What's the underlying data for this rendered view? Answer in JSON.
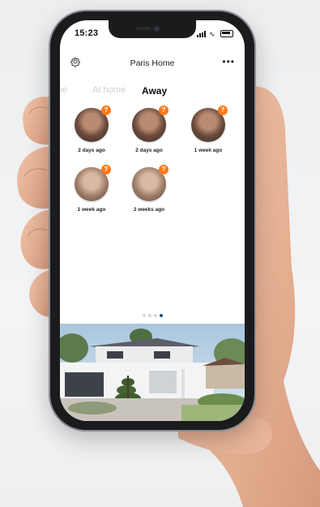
{
  "status_bar": {
    "time": "15:23"
  },
  "header": {
    "title": "Paris Home",
    "more_label": "•••"
  },
  "tabs": [
    {
      "label": "me"
    },
    {
      "label": "At home"
    },
    {
      "label": "Away",
      "active": true
    }
  ],
  "faces": [
    {
      "badge": "?",
      "label": "2 days ago"
    },
    {
      "badge": "?",
      "label": "2 days ago"
    },
    {
      "badge": "?",
      "label": "1 week ago"
    },
    {
      "badge": "?",
      "label": "1 week ago"
    },
    {
      "badge": "?",
      "label": "2 weeks ago"
    }
  ],
  "pager": {
    "pages": 4,
    "active_index": 3
  },
  "icons": {
    "settings": "gear-icon",
    "more": "more-dots-icon",
    "badge": "question-badge-icon"
  },
  "colors": {
    "accent": "#ff7a1a",
    "pager_active": "#1f4f8c"
  }
}
